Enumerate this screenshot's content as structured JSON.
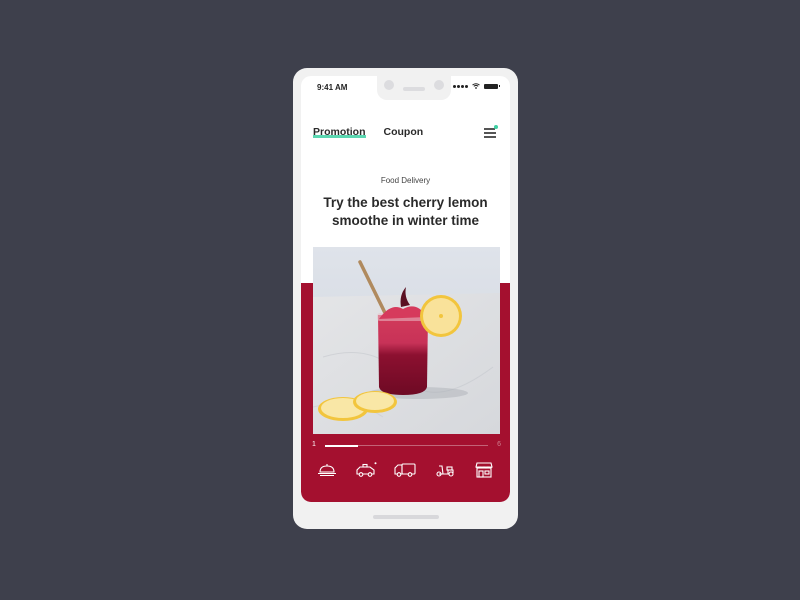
{
  "status_bar": {
    "time": "9:41 AM",
    "icons": [
      "signal-icon",
      "wifi-icon",
      "battery-icon"
    ]
  },
  "nav": {
    "tabs": [
      {
        "label": "Promotion",
        "active": true
      },
      {
        "label": "Coupon",
        "active": false
      }
    ],
    "menu_icon": "hamburger-menu-icon",
    "has_notification": true
  },
  "promo": {
    "category": "Food Delivery",
    "headline": "Try the best cherry lemon smoothe in winter time",
    "image_subject": "cherry lemon smoothie jar with straw and lemon slices"
  },
  "pager": {
    "current": "1",
    "total": "6",
    "progress_fraction": 0.2
  },
  "delivery_icons": [
    {
      "name": "food-cloche-icon",
      "label": "Food"
    },
    {
      "name": "taxi-icon",
      "label": "Taxi",
      "badge": true
    },
    {
      "name": "truck-icon",
      "label": "Truck"
    },
    {
      "name": "scooter-icon",
      "label": "Scooter"
    },
    {
      "name": "store-icon",
      "label": "Store"
    }
  ],
  "colors": {
    "background": "#3e404c",
    "accent_green": "#3ed0a3",
    "panel_red": "#a4102f",
    "phone_frame": "#f1f1f1"
  }
}
